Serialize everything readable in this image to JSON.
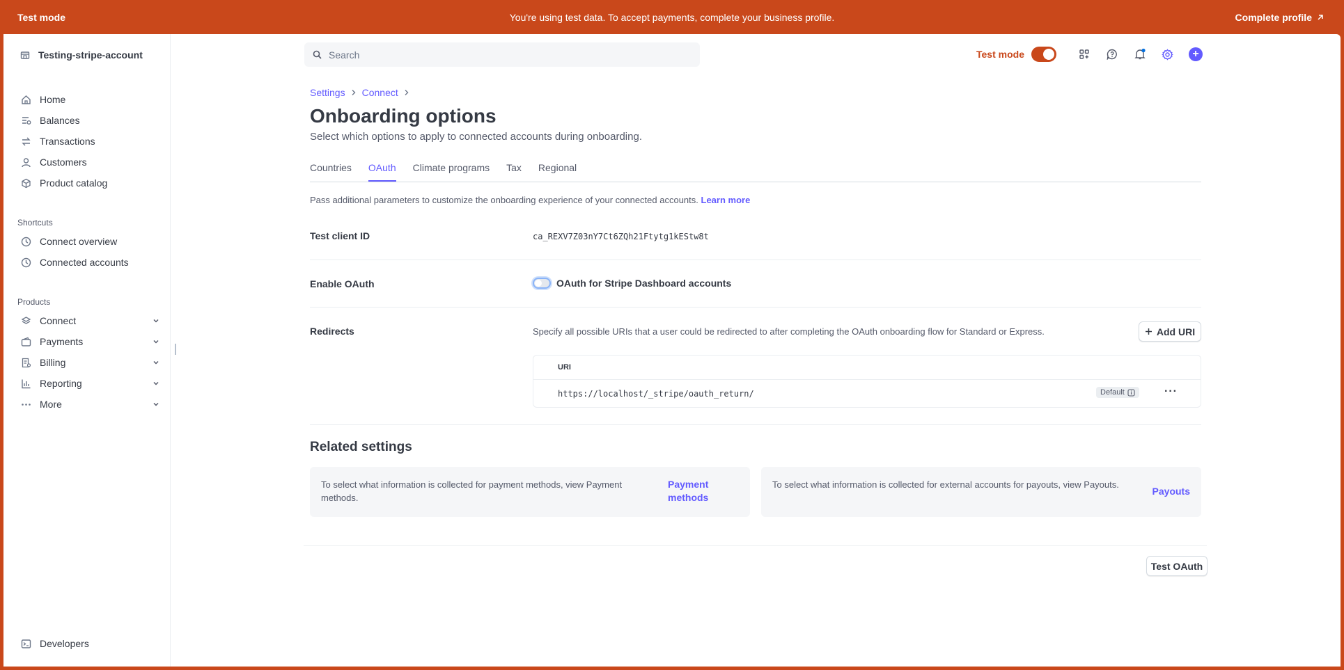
{
  "banner": {
    "left": "Test mode",
    "message": "You're using test data. To accept payments, complete your business profile.",
    "cta": "Complete profile"
  },
  "sidebar": {
    "account": "Testing-stripe-account",
    "primary": [
      {
        "label": "Home",
        "icon": "home-icon"
      },
      {
        "label": "Balances",
        "icon": "balances-icon"
      },
      {
        "label": "Transactions",
        "icon": "transactions-icon"
      },
      {
        "label": "Customers",
        "icon": "customers-icon"
      },
      {
        "label": "Product catalog",
        "icon": "product-catalog-icon"
      }
    ],
    "shortcuts_label": "Shortcuts",
    "shortcuts": [
      {
        "label": "Connect overview",
        "icon": "clock-icon"
      },
      {
        "label": "Connected accounts",
        "icon": "clock-icon"
      }
    ],
    "products_label": "Products",
    "products": [
      {
        "label": "Connect",
        "icon": "connect-icon"
      },
      {
        "label": "Payments",
        "icon": "payments-icon"
      },
      {
        "label": "Billing",
        "icon": "billing-icon"
      },
      {
        "label": "Reporting",
        "icon": "reporting-icon"
      },
      {
        "label": "More",
        "icon": "more-icon"
      }
    ],
    "developers": "Developers"
  },
  "topbar": {
    "search_placeholder": "Search",
    "test_mode_label": "Test mode",
    "test_mode_on": true
  },
  "breadcrumb": [
    "Settings",
    "Connect"
  ],
  "page": {
    "title": "Onboarding options",
    "subtitle": "Select which options to apply to connected accounts during onboarding."
  },
  "tabs": [
    {
      "label": "Countries",
      "active": false
    },
    {
      "label": "OAuth",
      "active": true
    },
    {
      "label": "Climate programs",
      "active": false
    },
    {
      "label": "Tax",
      "active": false
    },
    {
      "label": "Regional",
      "active": false
    }
  ],
  "oauth": {
    "info_text": "Pass additional parameters to customize the onboarding experience of your connected accounts.",
    "learn_more": "Learn more",
    "client_id_label": "Test client ID",
    "client_id": "ca_REXV7Z03nY7Ct6ZQh21Ftytg1kEStw8t",
    "enable_label": "Enable OAuth",
    "enable_toggle_text": "OAuth for Stripe Dashboard accounts",
    "enable_on": false,
    "redirects_label": "Redirects",
    "redirects_desc": "Specify all possible URIs that a user could be redirected to after completing the OAuth onboarding flow for Standard or Express.",
    "add_uri": "Add URI",
    "uri_header": "URI",
    "uris": [
      {
        "uri": "https://localhost/_stripe/oauth_return/",
        "badge": "Default"
      }
    ]
  },
  "related": {
    "title": "Related settings",
    "cards": [
      {
        "text": "To select what information is collected for payment methods, view Payment methods.",
        "link": "Payment methods"
      },
      {
        "text": "To select what information is collected for external accounts for payouts, view Payouts.",
        "link": "Payouts"
      }
    ]
  },
  "footer": {
    "test_button": "Test OAuth"
  },
  "colors": {
    "accent": "#635bff",
    "test_mode": "#c9481b"
  }
}
